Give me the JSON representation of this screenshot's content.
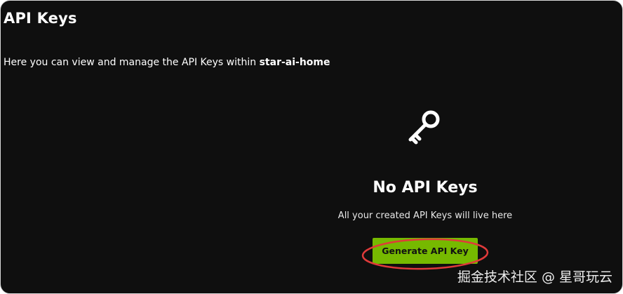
{
  "header": {
    "title": "API Keys"
  },
  "intro": {
    "text": "Here you can view and manage the API Keys within ",
    "project_name": "star-ai-home"
  },
  "empty_state": {
    "icon": "key-icon",
    "title": "No API Keys",
    "description": "All your created API Keys will live here",
    "button_label": "Generate API Key"
  },
  "annotation": {
    "color": "#e03a3a"
  },
  "watermark": {
    "text": "掘金技术社区 @ 星哥玩云"
  },
  "colors": {
    "background": "#0f0f0f",
    "accent": "#76b900",
    "text": "#ffffff"
  }
}
